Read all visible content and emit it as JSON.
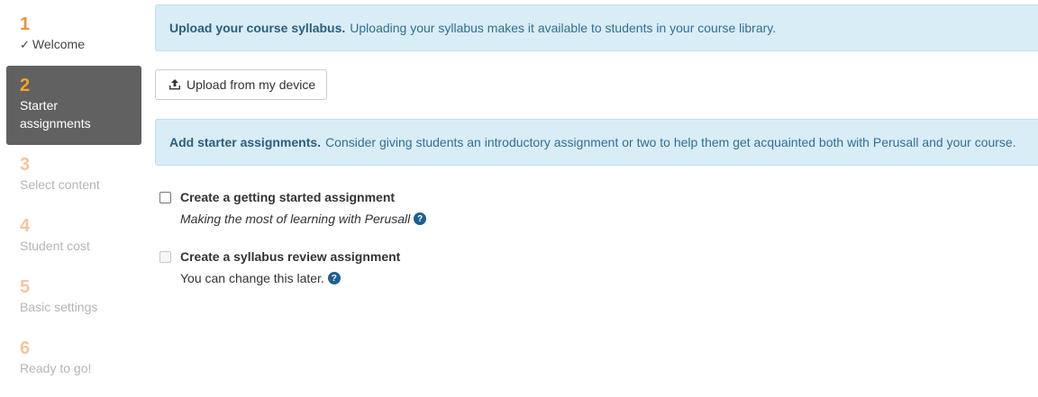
{
  "wizard": {
    "steps": [
      {
        "number": "1",
        "label": "Welcome",
        "state": "done"
      },
      {
        "number": "2",
        "label": "Starter assignments",
        "state": "active"
      },
      {
        "number": "3",
        "label": "Select content",
        "state": "todo"
      },
      {
        "number": "4",
        "label": "Student cost",
        "state": "todo"
      },
      {
        "number": "5",
        "label": "Basic settings",
        "state": "todo"
      },
      {
        "number": "6",
        "label": "Ready to go!",
        "state": "todo"
      }
    ]
  },
  "syllabus_callout": {
    "title": "Upload your course syllabus.",
    "text": "Uploading your syllabus makes it available to students in your course library."
  },
  "upload": {
    "label": "Upload from my device",
    "icon": "upload-icon"
  },
  "starter_callout": {
    "title": "Add starter assignments.",
    "text": "Consider giving students an introductory assignment or two to help them get acquainted both with Perusall and your course."
  },
  "options": [
    {
      "title": "Create a getting started assignment",
      "subtitle": "Making the most of learning with Perusall",
      "checked": false,
      "disabled": false
    },
    {
      "title": "Create a syllabus review assignment",
      "subtitle": "You can change this later.",
      "checked": false,
      "disabled": true
    }
  ],
  "help_icon_glyph": "?",
  "colors": {
    "step_done": "#e8923f",
    "step_active_bg": "#616161",
    "step_active_number": "#f5a623",
    "step_todo": "#f2c6a0",
    "callout_bg": "#d9edf7",
    "callout_text": "#31708f",
    "help_icon": "#1f5f8f"
  }
}
